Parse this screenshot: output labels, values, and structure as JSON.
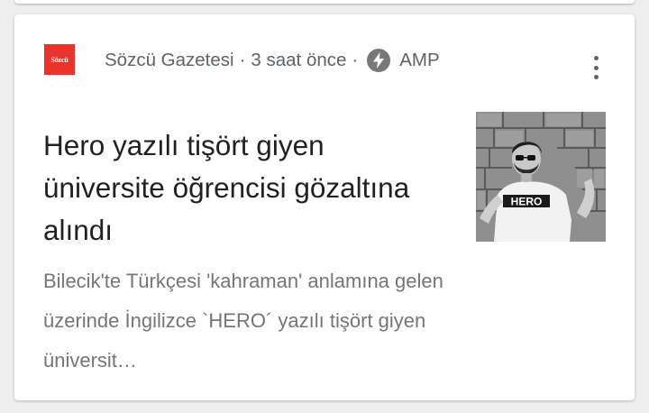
{
  "card": {
    "source": {
      "logo_text": "Sözcü",
      "name": "Sözcü Gazetesi",
      "separator": "·",
      "time": "3 saat önce",
      "amp_label": "AMP",
      "amp_icon": "lightning-bolt-icon"
    },
    "menu_icon": "more-vert-icon",
    "headline": "Hero yazılı tişört giyen üniversite öğrencisi gözaltına alındı",
    "snippet": "Bilecik'te Türkçesi 'kahraman' anlamına gelen üzerinde İngilizce `HERO´ yazılı tişört giyen üniversit…",
    "thumbnail": {
      "shirt_text": "HERO"
    }
  },
  "colors": {
    "logo_red": "#e8352b",
    "meta_gray": "#5f6368",
    "title_black": "#202124",
    "snippet_gray": "#757575",
    "background": "#eeeeee"
  }
}
